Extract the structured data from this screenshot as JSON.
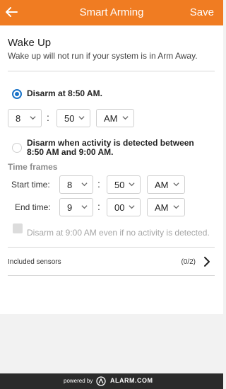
{
  "header": {
    "title": "Smart Arming",
    "save_label": "Save"
  },
  "main": {
    "heading": "Wake Up",
    "subtitle": "Wake up will not run if your system is in Arm Away.",
    "option_fixed": {
      "label": "Disarm at 8:50 AM.",
      "selected": true
    },
    "fixed_time": {
      "hour": "8",
      "minute": "50",
      "ampm": "AM"
    },
    "option_activity": {
      "line1": "Disarm when activity is detected between",
      "line2": "8:50 AM and 9:00 AM.",
      "selected": false
    },
    "time_frames_label": "Time frames",
    "start": {
      "label": "Start time:",
      "hour": "8",
      "minute": "50",
      "ampm": "AM"
    },
    "end": {
      "label": "End time:",
      "hour": "9",
      "minute": "00",
      "ampm": "AM"
    },
    "no_activity_check": {
      "label": "Disarm at 9:00 AM even if no activity is detected.",
      "checked": false
    },
    "sensors": {
      "label": "Included sensors",
      "count": "(0/2)"
    }
  },
  "footer": {
    "powered_by": "powered by",
    "brand": "ALARM.COM"
  },
  "colors": {
    "accent": "#f07c22",
    "radio": "#1a73c8",
    "footer_bg": "#2b2b2b"
  }
}
